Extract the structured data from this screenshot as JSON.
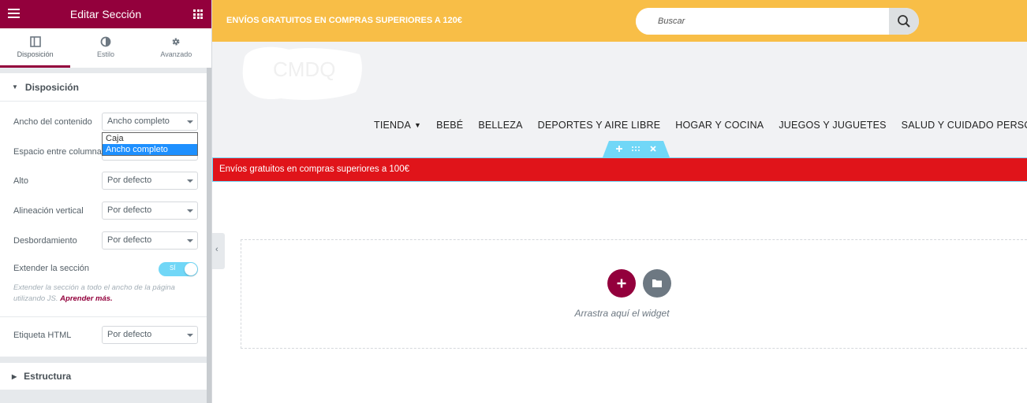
{
  "panel": {
    "title": "Editar Sección",
    "tabs": [
      {
        "label": "Disposición",
        "icon": "columns-icon",
        "active": true
      },
      {
        "label": "Estilo",
        "icon": "half-circle-icon",
        "active": false
      },
      {
        "label": "Avanzado",
        "icon": "gear-icon",
        "active": false
      }
    ],
    "section_title": "Disposición",
    "controls": {
      "content_width": {
        "label": "Ancho del contenido",
        "value": "Ancho completo",
        "options": [
          "Caja",
          "Ancho completo"
        ]
      },
      "column_gap": {
        "label": "Espacio entre columnas"
      },
      "height": {
        "label": "Alto",
        "value": "Por defecto"
      },
      "vertical_align": {
        "label": "Alineación vertical",
        "value": "Por defecto"
      },
      "overflow": {
        "label": "Desbordamiento",
        "value": "Por defecto"
      },
      "stretch": {
        "label": "Extender la sección",
        "toggle_label": "SÍ",
        "on": true
      },
      "stretch_help": "Extender la sección a todo el ancho de la página utilizando JS.",
      "stretch_help_link": "Aprender más.",
      "html_tag": {
        "label": "Etiqueta HTML",
        "value": "Por defecto"
      }
    },
    "section2_title": "Estructura"
  },
  "canvas": {
    "top_promo": "ENVÍOS GRATUITOS EN COMPRAS SUPERIORES A 120€",
    "search_placeholder": "Buscar",
    "logo_text": "CMDQ",
    "nav": [
      {
        "label": "TIENDA",
        "has_dropdown": true
      },
      {
        "label": "BEBÉ"
      },
      {
        "label": "BELLEZA"
      },
      {
        "label": "DEPORTES Y AIRE LIBRE"
      },
      {
        "label": "HOGAR Y COCINA"
      },
      {
        "label": "JUEGOS Y JUGUETES"
      },
      {
        "label": "SALUD Y CUIDADO PERSONAL"
      }
    ],
    "red_banner": "Envíos gratuitos en compras superiores a 100€",
    "drop_hint": "Arrastra aquí el widget"
  },
  "colors": {
    "brand": "#93003c",
    "topbar": "#f8be47",
    "red_banner": "#e0141a",
    "accent_blue": "#71d7f7"
  }
}
